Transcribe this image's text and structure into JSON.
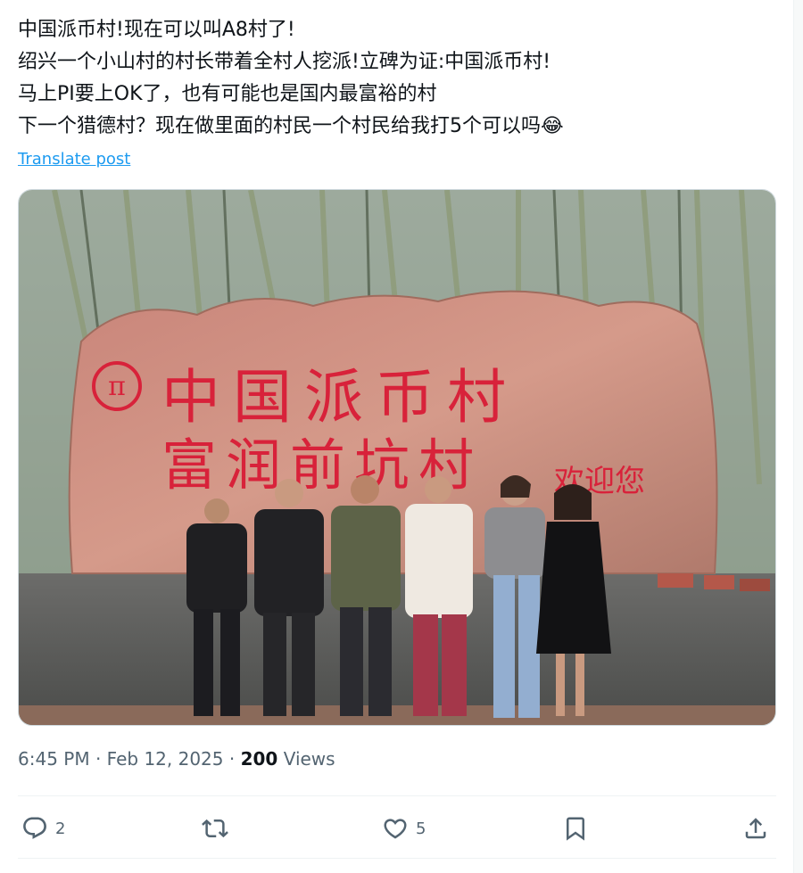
{
  "post": {
    "lines": [
      "中国派币村!现在可以叫A8村了!",
      "绍兴一个小山村的村长带着全村人挖派!立碑为证:中国派币村!",
      "马上PI要上OK了，也有可能也是国内最富裕的村",
      "下一个猎德村？现在做里面的村民一个村民给我打5个可以吗😂"
    ],
    "translate_label": "Translate post"
  },
  "image": {
    "stone_line1": "中国派币村",
    "stone_line2": "富润前坑村",
    "stone_welcome": "欢迎您",
    "stone_logo": "π"
  },
  "meta": {
    "time": "6:45 PM",
    "date": "Feb 12, 2025",
    "separator": "·",
    "views_count": "200",
    "views_label": "Views"
  },
  "actions": {
    "reply_count": "2",
    "retweet_count": "",
    "like_count": "5"
  },
  "colors": {
    "link": "#1d9bf0",
    "text": "#0f1419",
    "muted": "#536471",
    "stone_text": "#d8223a"
  },
  "icons": {
    "reply": "reply-icon",
    "retweet": "retweet-icon",
    "like": "heart-icon",
    "bookmark": "bookmark-icon",
    "share": "share-icon"
  }
}
